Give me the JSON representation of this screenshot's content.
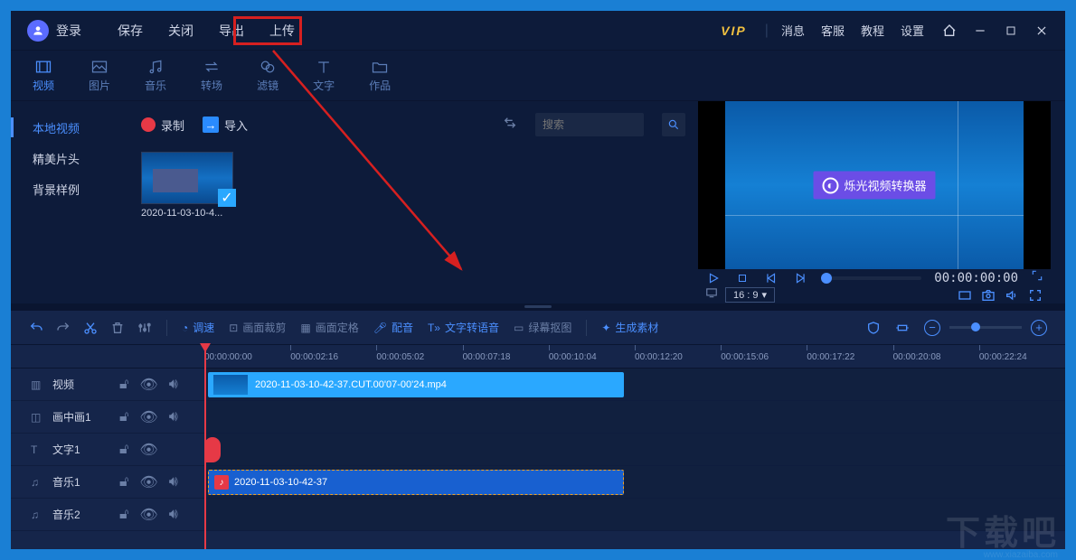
{
  "titlebar": {
    "login": "登录",
    "menu": [
      "保存",
      "关闭",
      "导出",
      "上传"
    ],
    "vip": "VIP",
    "links": [
      "消息",
      "客服",
      "教程",
      "设置"
    ]
  },
  "categories": [
    {
      "label": "视频",
      "icon": "film"
    },
    {
      "label": "图片",
      "icon": "image"
    },
    {
      "label": "音乐",
      "icon": "music"
    },
    {
      "label": "转场",
      "icon": "swap"
    },
    {
      "label": "滤镜",
      "icon": "circles"
    },
    {
      "label": "文字",
      "icon": "text"
    },
    {
      "label": "作品",
      "icon": "folder"
    }
  ],
  "side_tabs": [
    "本地视频",
    "精美片头",
    "背景样例"
  ],
  "asset_toolbar": {
    "record": "录制",
    "import": "导入",
    "search_placeholder": "搜索"
  },
  "thumbnail": {
    "label": "2020-11-03-10-4..."
  },
  "preview": {
    "badge_text": "烁光视频转换器",
    "time": "00:00:00:00",
    "aspect": "16 : 9"
  },
  "timeline_toolbar": {
    "speed": "调速",
    "crop": "画面裁剪",
    "freeze": "画面定格",
    "dub": "配音",
    "tts": "文字转语音",
    "greenscreen": "绿幕抠图",
    "generate": "生成素材"
  },
  "ruler": [
    "00:00:00:00",
    "00:00:02:16",
    "00:00:05:02",
    "00:00:07:18",
    "00:00:10:04",
    "00:00:12:20",
    "00:00:15:06",
    "00:00:17:22",
    "00:00:20:08",
    "00:00:22:24"
  ],
  "tracks": [
    {
      "icon": "film",
      "label": "视频"
    },
    {
      "icon": "pip",
      "label": "画中画1"
    },
    {
      "icon": "text",
      "label": "文字1"
    },
    {
      "icon": "music",
      "label": "音乐1"
    },
    {
      "icon": "music",
      "label": "音乐2"
    }
  ],
  "clips": {
    "video_name": "2020-11-03-10-42-37.CUT.00'07-00'24.mp4",
    "audio_name": "2020-11-03-10-42-37"
  },
  "watermark": "下载吧",
  "watermark_url": "www.xiazaiba.com"
}
